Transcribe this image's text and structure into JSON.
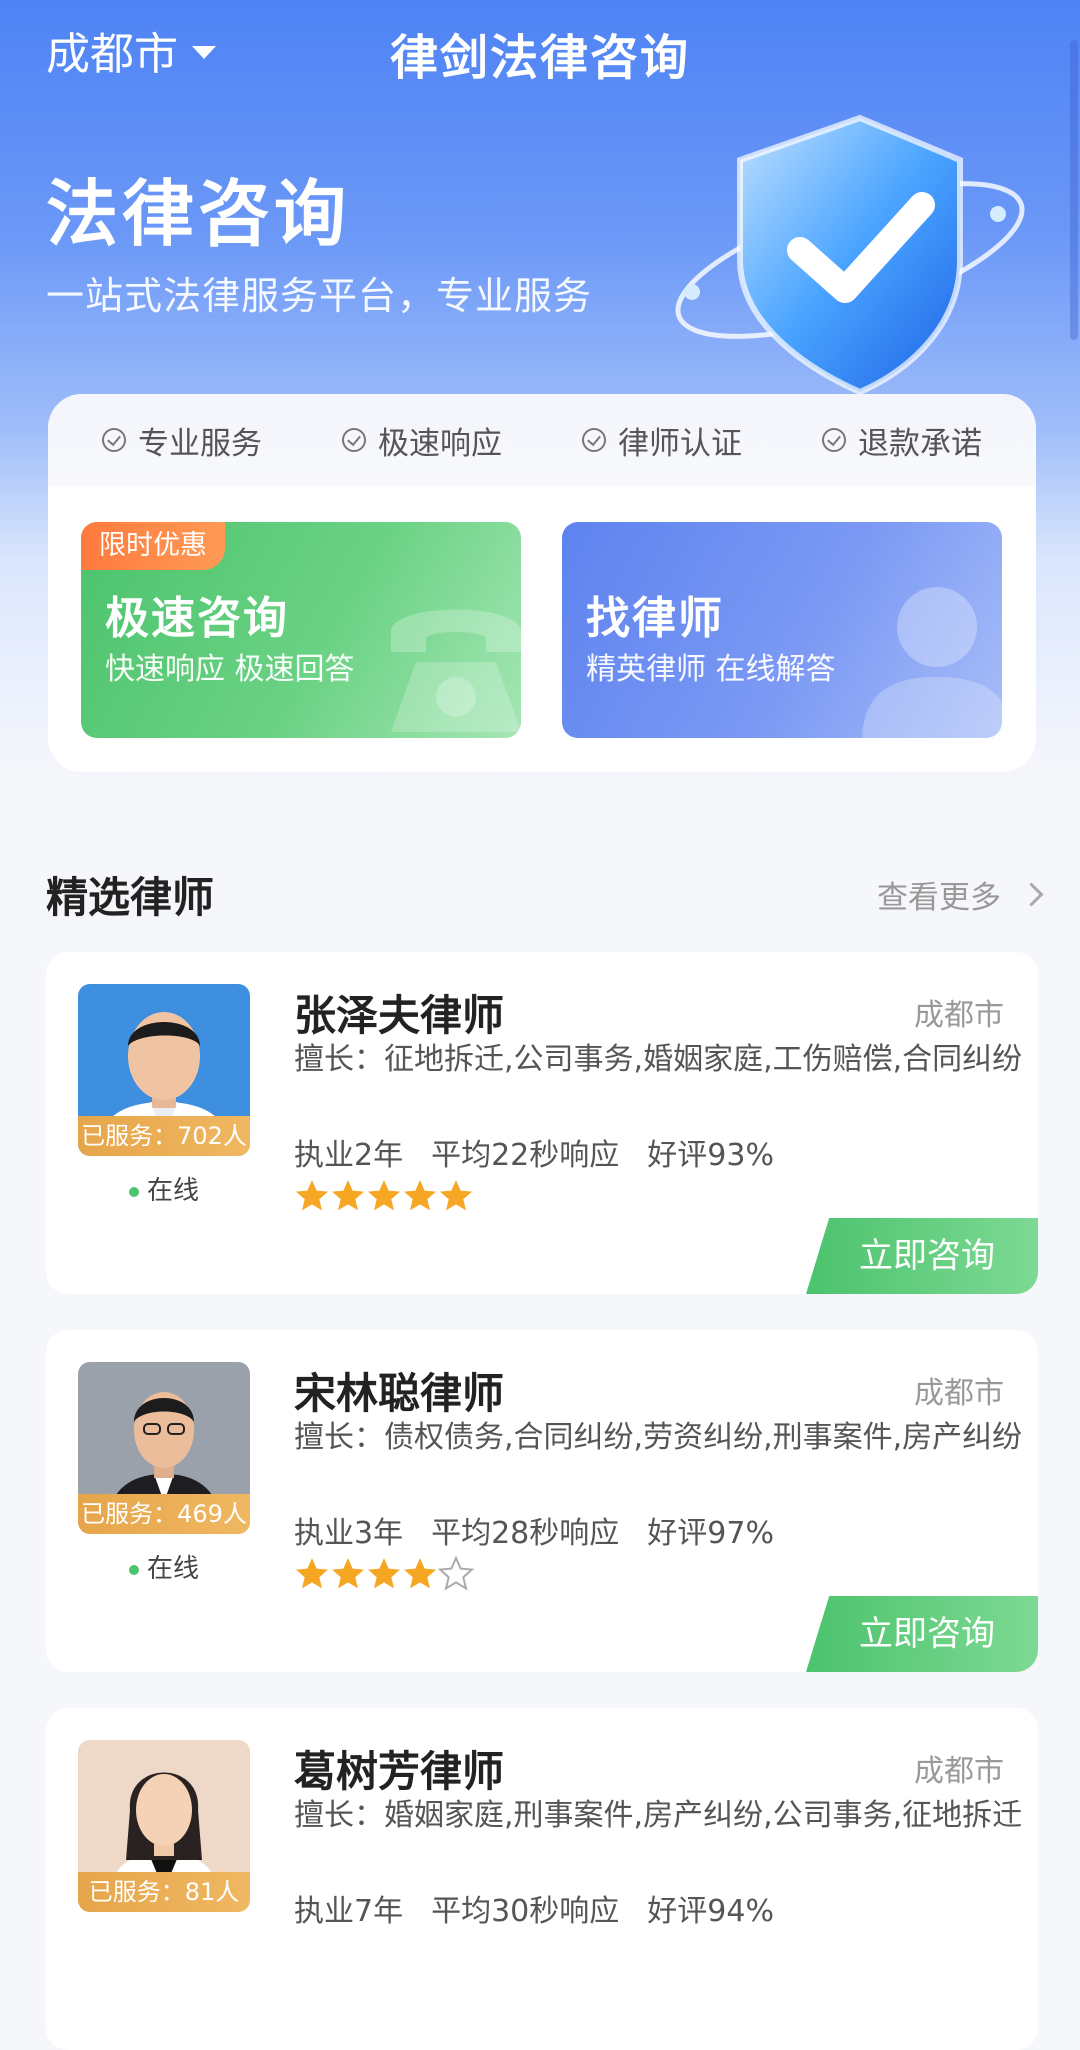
{
  "header": {
    "city": "成都市",
    "title": "律剑法律咨询"
  },
  "hero": {
    "title": "法律咨询",
    "subtitle": "一站式法律服务平台，专业服务"
  },
  "features": [
    "专业服务",
    "极速响应",
    "律师认证",
    "退款承诺"
  ],
  "cards": {
    "fast": {
      "badge": "限时优惠",
      "title": "极速咨询",
      "subtitle": "快速响应 极速回答"
    },
    "find": {
      "title": "找律师",
      "subtitle": "精英律师 在线解答"
    }
  },
  "section": {
    "title": "精选律师",
    "more": "查看更多"
  },
  "lawyers": [
    {
      "name": "张泽夫律师",
      "city": "成都市",
      "specialty": "擅长：征地拆迁,公司事务,婚姻家庭,工伤赔偿,合同纠纷",
      "served": "已服务：702人",
      "status": "在线",
      "years": "执业2年",
      "response": "平均22秒响应",
      "rating": "好评93%",
      "stars": 5,
      "button": "立即咨询"
    },
    {
      "name": "宋林聪律师",
      "city": "成都市",
      "specialty": "擅长：债权债务,合同纠纷,劳资纠纷,刑事案件,房产纠纷",
      "served": "已服务：469人",
      "status": "在线",
      "years": "执业3年",
      "response": "平均28秒响应",
      "rating": "好评97%",
      "stars": 4,
      "button": "立即咨询"
    },
    {
      "name": "葛树芳律师",
      "city": "成都市",
      "specialty": "擅长：婚姻家庭,刑事案件,房产纠纷,公司事务,征地拆迁",
      "served": "已服务：81人",
      "years": "执业7年",
      "response": "平均30秒响应",
      "rating": "好评94%"
    }
  ],
  "colors": {
    "primary_blue": "#4e83f5",
    "green": "#4cc36d",
    "gold": "#f5a623",
    "orange": "#ff7a3d"
  }
}
